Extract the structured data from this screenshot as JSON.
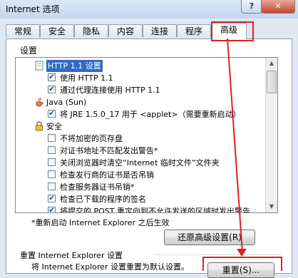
{
  "window": {
    "title": "Internet 选项",
    "help_label": "?",
    "close_label": "✕"
  },
  "tabs": [
    "常规",
    "安全",
    "隐私",
    "内容",
    "连接",
    "程序",
    "高级"
  ],
  "active_tab": "高级",
  "settings": {
    "group_label": "设置",
    "items": [
      {
        "kind": "folder",
        "label": "HTTP 1.1 设置",
        "selected": true
      },
      {
        "kind": "checkbox",
        "label": "使用 HTTP 1.1",
        "checked": true
      },
      {
        "kind": "checkbox",
        "label": "通过代理连接使用 HTTP 1.1",
        "checked": true
      },
      {
        "kind": "java",
        "label": "Java (Sun)"
      },
      {
        "kind": "checkbox",
        "label": "将 JRE 1.5.0_17 用于 <applet>（需要重新启动）",
        "checked": true
      },
      {
        "kind": "lock",
        "label": "安全"
      },
      {
        "kind": "checkbox",
        "label": "不将加密的页存盘",
        "checked": false
      },
      {
        "kind": "checkbox",
        "label": "对证书地址不匹配发出警告*",
        "checked": false
      },
      {
        "kind": "checkbox",
        "label": "关闭浏览器时清空“Internet 临时文件”文件夹",
        "checked": false
      },
      {
        "kind": "checkbox",
        "label": "检查发行商的证书是否吊销",
        "checked": false
      },
      {
        "kind": "checkbox",
        "label": "检查服务器证书吊销*",
        "checked": false
      },
      {
        "kind": "checkbox",
        "label": "检查已下载的程序的签名",
        "checked": true
      },
      {
        "kind": "checkbox",
        "label": "将提交的 POST 重定向到不允许发送的区域时发出警告",
        "checked": true
      }
    ]
  },
  "restart_note": "*重新启动 Internet Explorer 之后生效",
  "restore_button": "还原高级设置(R)",
  "reset_group_label": "重置 Internet Explorer 设置",
  "reset_desc": "将 Internet Explorer 设置重置为默认设置。",
  "reset_button": "重置(S)...",
  "colors": {
    "annotation": "#e02020",
    "selection": "#3169c6"
  }
}
